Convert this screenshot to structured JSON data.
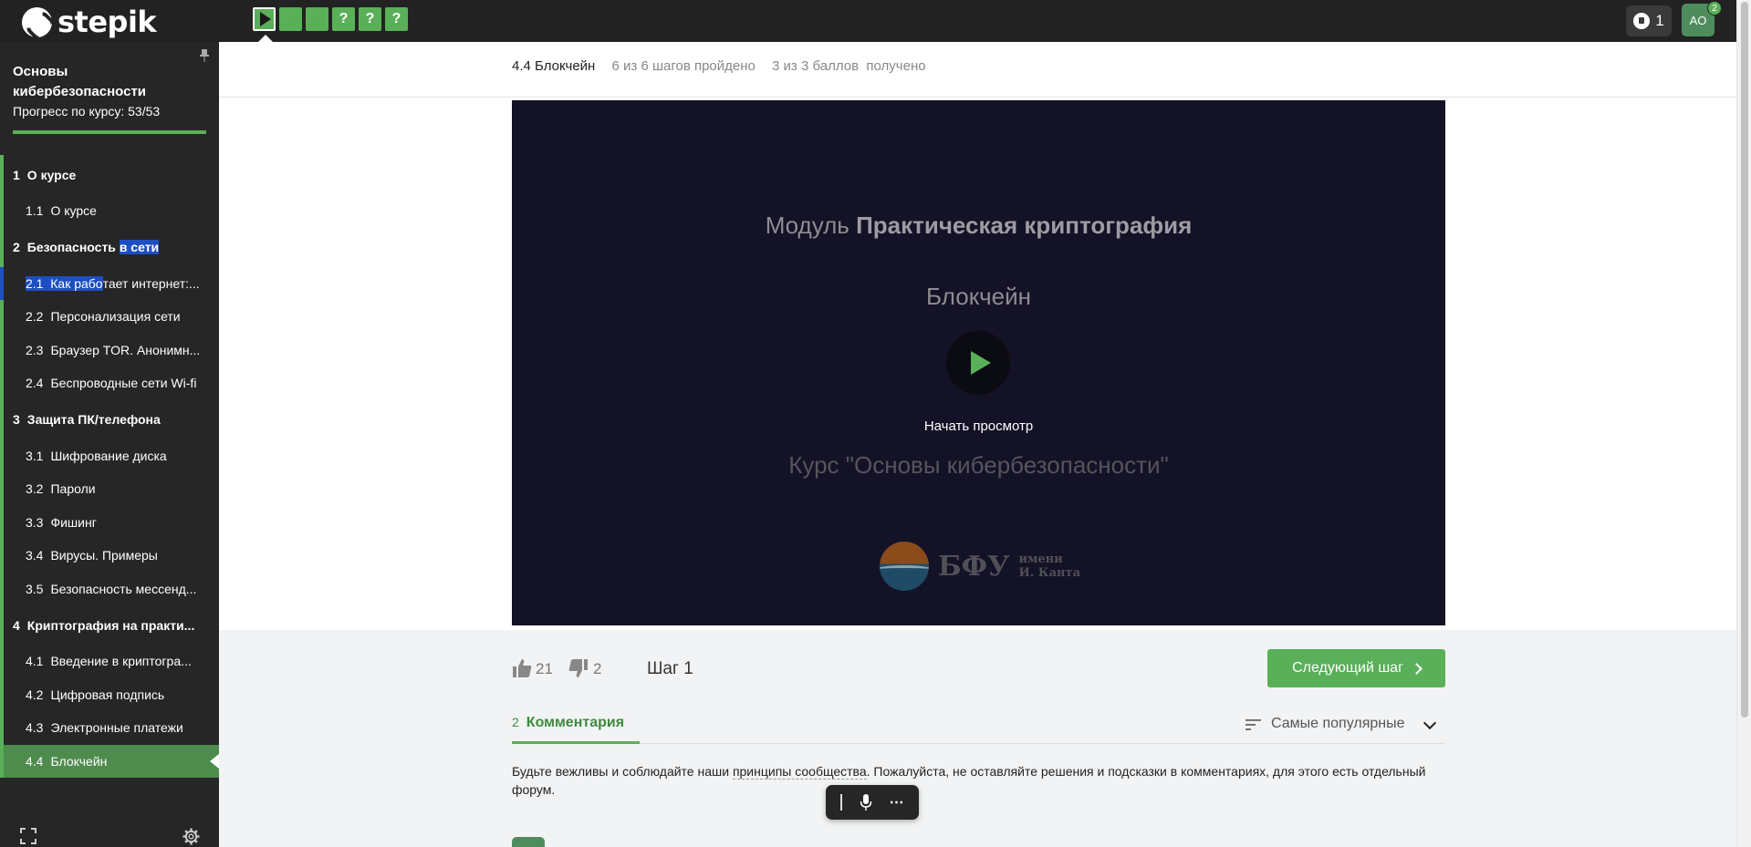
{
  "topbar": {
    "logo_text": "stepik",
    "steps": [
      {
        "type": "video",
        "label": "",
        "current": true
      },
      {
        "type": "text",
        "label": "",
        "current": false
      },
      {
        "type": "text",
        "label": "",
        "current": false
      },
      {
        "type": "quiz",
        "label": "?",
        "current": false
      },
      {
        "type": "quiz",
        "label": "?",
        "current": false
      },
      {
        "type": "quiz",
        "label": "?",
        "current": false
      }
    ],
    "notifications_count": "1",
    "avatar_initials": "AO",
    "avatar_badge": "2"
  },
  "sidebar": {
    "course_title": "Основы кибербезопасности",
    "progress_text": "Прогресс по курсу:  53/53",
    "progress_fraction": 1.0,
    "sections": [
      {
        "num": "1",
        "title": "О курсе",
        "lessons": [
          {
            "num": "1.1",
            "title": "О курсе"
          }
        ]
      },
      {
        "num": "2",
        "title_a": "Безопасность ",
        "title_b": "в сети",
        "lessons": [
          {
            "num": "2.1",
            "title_a": "Как рабо",
            "title_b": "тает интернет:..."
          },
          {
            "num": "2.2",
            "title": "Персонализация сети"
          },
          {
            "num": "2.3",
            "title": "Браузер TOR. Анонимн..."
          },
          {
            "num": "2.4",
            "title": "Беспроводные сети Wi-fi"
          }
        ]
      },
      {
        "num": "3",
        "title": "Защита ПК/телефона",
        "lessons": [
          {
            "num": "3.1",
            "title": "Шифрование диска"
          },
          {
            "num": "3.2",
            "title": "Пароли"
          },
          {
            "num": "3.3",
            "title": "Фишинг"
          },
          {
            "num": "3.4",
            "title": "Вирусы. Примеры"
          },
          {
            "num": "3.5",
            "title": "Безопасность мессенд..."
          }
        ]
      },
      {
        "num": "4",
        "title": "Криптография на практи...",
        "lessons": [
          {
            "num": "4.1",
            "title": "Введение в криптогра..."
          },
          {
            "num": "4.2",
            "title": "Цифровая подпись"
          },
          {
            "num": "4.3",
            "title": "Электронные платежи"
          },
          {
            "num": "4.4",
            "title": "Блокчейн"
          }
        ]
      }
    ]
  },
  "lesson": {
    "title": "4.4 Блокчейн",
    "steps_progress": "6 из 6 шагов пройдено",
    "score": "3 из 3 баллов  получено"
  },
  "video": {
    "module_prefix": "Модуль ",
    "module_name": "Практическая криптография",
    "lesson_name": "Блокчейн",
    "start_label": "Начать просмотр",
    "course_line": "Курс \"Основы кибербезопасности\"",
    "logo_name": "БФУ",
    "logo_sub_1": "имени",
    "logo_sub_2": "И. Канта"
  },
  "step_bar": {
    "likes": "21",
    "dislikes": "2",
    "step_label": "Шаг 1",
    "next_button": "Следующий шаг"
  },
  "comments": {
    "count": "2",
    "tab_label": "Комментария",
    "sort_label": "Самые популярные",
    "rules_before": "Будьте вежливы и соблюдайте наши ",
    "rules_link": "принципы сообщества",
    "rules_after": ". Пожалуйста, не оставляйте решения и подсказки в комментариях, для этого есть отдельный форум."
  },
  "colors": {
    "accent": "#59b058",
    "sidebar_bg": "#262626",
    "topbar_bg": "#222222",
    "selection": "#1e4fc2",
    "video_bg": "#131226"
  }
}
